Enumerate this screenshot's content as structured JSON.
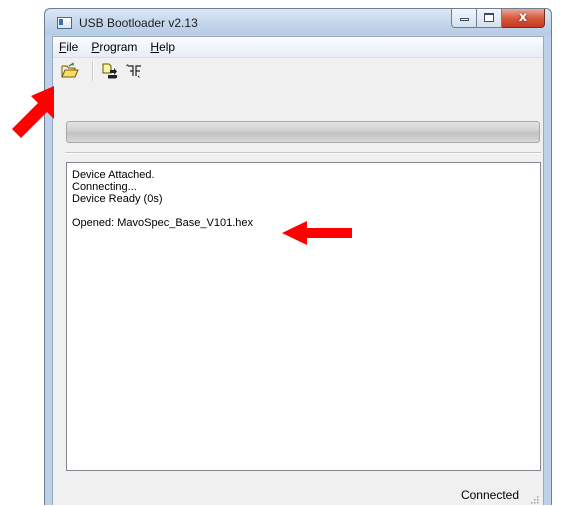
{
  "window": {
    "title": "USB Bootloader v2.13",
    "controls": {
      "minimize": "minimize",
      "maximize": "maximize",
      "close_glyph": "x"
    }
  },
  "menu": {
    "items": [
      {
        "accel": "F",
        "rest": "ile"
      },
      {
        "accel": "P",
        "rest": "rogram"
      },
      {
        "accel": "H",
        "rest": "elp"
      }
    ]
  },
  "toolbar": {
    "buttons": [
      {
        "icon": "open-folder-icon"
      },
      {
        "icon": "write-device-icon"
      },
      {
        "icon": "reset-device-icon"
      }
    ]
  },
  "progress": {
    "value": 0
  },
  "log": {
    "lines": [
      "Device Attached.",
      "Connecting...",
      "Device Ready (0s)",
      "",
      "Opened: MavoSpec_Base_V101.hex"
    ]
  },
  "status": {
    "text": "Connected"
  },
  "colors": {
    "annotation_arrow": "#ff0000",
    "progress_fill": "#4cc24c",
    "close_button": "#c43a20"
  }
}
